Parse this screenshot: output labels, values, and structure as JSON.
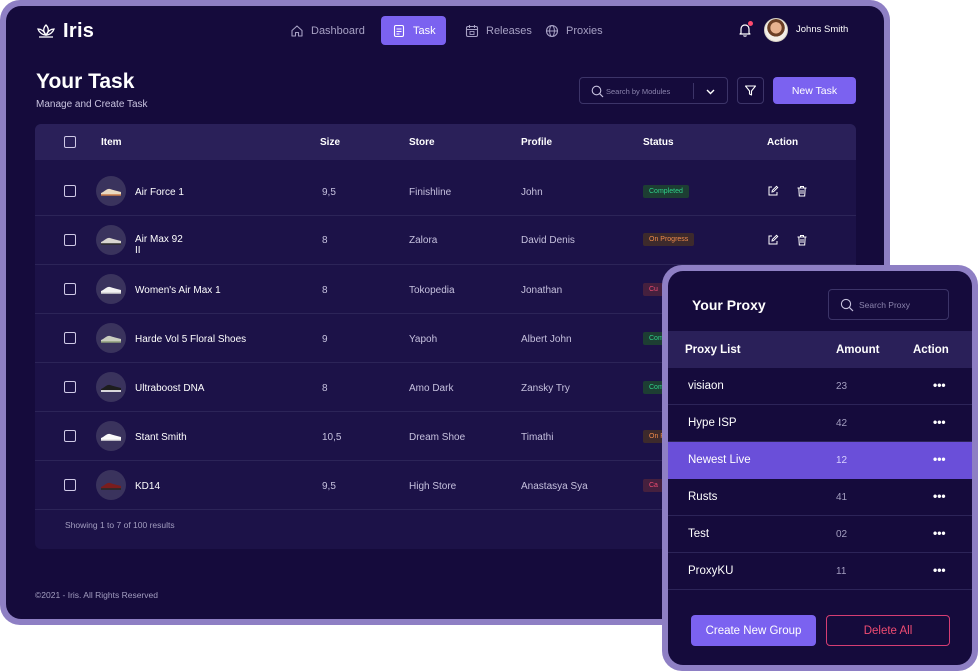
{
  "app": {
    "logo_text": "Iris"
  },
  "nav": {
    "items": [
      {
        "label": "Dashboard",
        "icon": "home-icon"
      },
      {
        "label": "Task",
        "icon": "task-icon",
        "active": true
      },
      {
        "label": "Releases",
        "icon": "calendar-icon"
      },
      {
        "label": "Proxies",
        "icon": "globe-icon"
      }
    ],
    "user_name": "Johns Smith"
  },
  "header": {
    "title": "Your Task",
    "subtitle": "Manage and Create Task",
    "search_placeholder": "Search by Modules",
    "new_task_label": "New Task"
  },
  "table": {
    "columns": [
      "Item",
      "Size",
      "Store",
      "Profile",
      "Status",
      "Action"
    ],
    "rows": [
      {
        "item": "Air Force 1",
        "size": "9,5",
        "store": "Finishline",
        "profile": "John",
        "status": "Completed"
      },
      {
        "item": "Air Max 92",
        "item_line2": "II",
        "size": "8",
        "store": "Zalora",
        "profile": "David Denis",
        "status": "On Progress"
      },
      {
        "item": "Women's Air Max 1",
        "size": "8",
        "store": "Tokopedia",
        "profile": "Jonathan",
        "status": "Cu"
      },
      {
        "item": "Harde Vol 5 Floral Shoes",
        "size": "9",
        "store": "Yapoh",
        "profile": "Albert John",
        "status": "Com"
      },
      {
        "item": "Ultraboost DNA",
        "size": "8",
        "store": "Amo Dark",
        "profile": "Zansky Try",
        "status": "Com"
      },
      {
        "item": "Stant Smith",
        "size": "10,5",
        "store": "Dream Shoe",
        "profile": "Timathi",
        "status": "On P"
      },
      {
        "item": "KD14",
        "size": "9,5",
        "store": "High Store",
        "profile": "Anastasya Sya",
        "status": "Ca"
      }
    ],
    "pagination": "Showing 1 to 7 of 100 results"
  },
  "footer": {
    "copyright": "©2021 - Iris.  All Rights Reserved"
  },
  "proxy": {
    "title": "Your Proxy",
    "search_placeholder": "Search Proxy",
    "columns": [
      "Proxy List",
      "Amount",
      "Action"
    ],
    "rows": [
      {
        "name": "visiaon",
        "amount": "23"
      },
      {
        "name": "Hype ISP",
        "amount": "42"
      },
      {
        "name": "Newest Live",
        "amount": "12",
        "selected": true
      },
      {
        "name": "Rusts",
        "amount": "41"
      },
      {
        "name": "Test",
        "amount": "02"
      },
      {
        "name": "ProxyKU",
        "amount": "11"
      }
    ],
    "action_glyph": "•••",
    "create_label": "Create New Group",
    "delete_label": "Delete All"
  },
  "colors": {
    "background": "#150b3c",
    "accent": "#7b62f0",
    "frame": "#8e7fc4",
    "completed": "#2fd38b",
    "on_progress": "#f08a4a",
    "cancelled": "#f04c72"
  }
}
